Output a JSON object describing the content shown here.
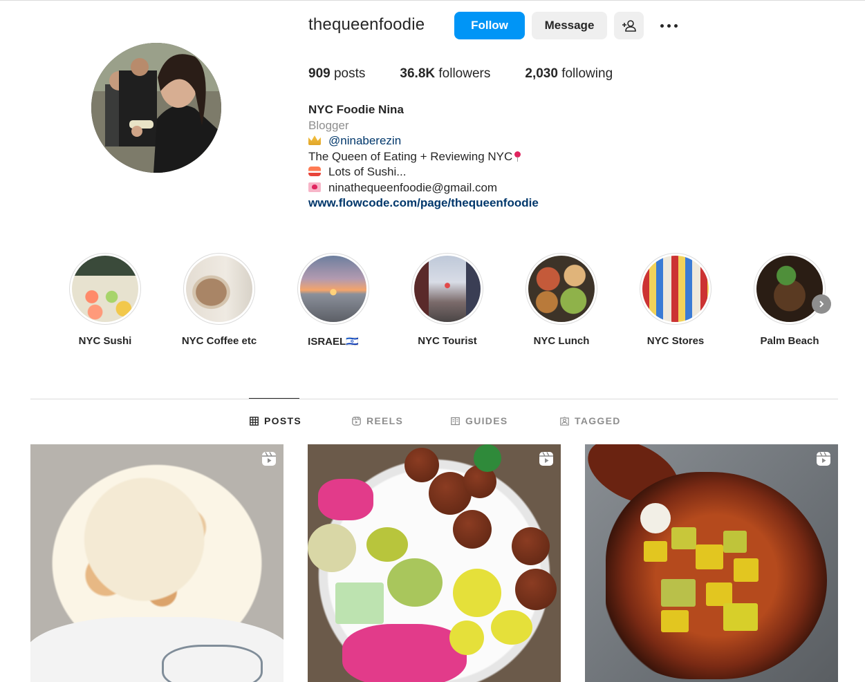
{
  "profile": {
    "username": "thequeenfoodie",
    "follow_label": "Follow",
    "message_label": "Message",
    "add_user_icon": "add-user-icon",
    "more_icon": "more-icon"
  },
  "stats": {
    "posts_value": "909",
    "posts_label": "posts",
    "followers_value": "36.8K",
    "followers_label": "followers",
    "following_value": "2,030",
    "following_label": "following"
  },
  "bio": {
    "name": "NYC Foodie Nina",
    "category": "Blogger",
    "mention": "@ninaberezin",
    "line1": "The Queen of Eating + Reviewing NYC",
    "line2": "Lots of Sushi...",
    "email": "ninathequeenfoodie@gmail.com",
    "link": "www.flowcode.com/page/thequeenfoodie"
  },
  "highlights": [
    {
      "label": "NYC Sushi"
    },
    {
      "label": "NYC Coffee etc"
    },
    {
      "label": "ISRAEL🇮🇱"
    },
    {
      "label": "NYC Tourist"
    },
    {
      "label": "NYC Lunch"
    },
    {
      "label": "NYC Stores"
    },
    {
      "label": "Palm Beach"
    }
  ],
  "tabs": [
    {
      "label": "POSTS",
      "icon": "grid-icon",
      "active": true
    },
    {
      "label": "REELS",
      "icon": "reels-icon",
      "active": false
    },
    {
      "label": "GUIDES",
      "icon": "guides-icon",
      "active": false
    },
    {
      "label": "TAGGED",
      "icon": "tagged-icon",
      "active": false
    }
  ],
  "colors": {
    "accent": "#0095f6",
    "link": "#00376b",
    "muted": "#8e8e8e"
  }
}
